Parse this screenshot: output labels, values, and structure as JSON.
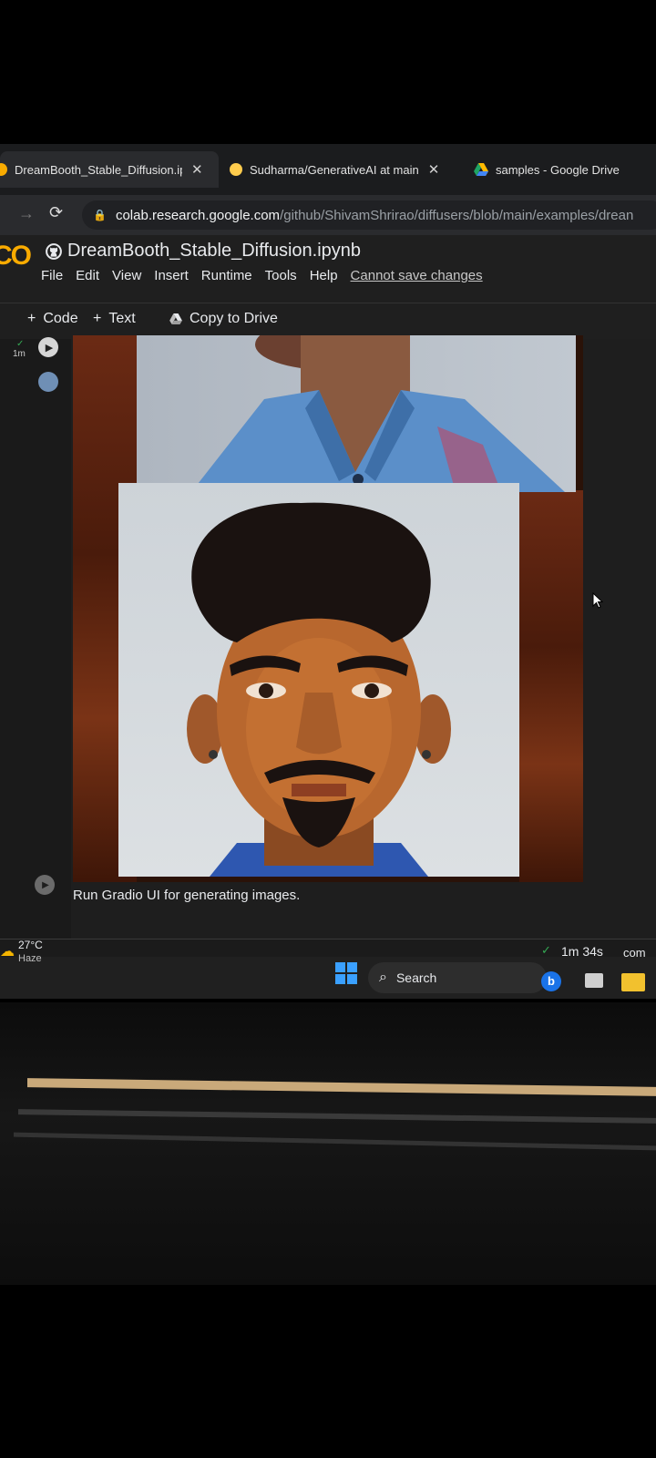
{
  "browser": {
    "tabs": [
      {
        "label": "DreamBooth_Stable_Diffusion.ipy",
        "active": true,
        "favicon_color": "#f9ab00"
      },
      {
        "label": "Sudharma/GenerativeAI at main",
        "active": false,
        "favicon_color": "#ffcc4d"
      },
      {
        "label": "samples - Google Drive",
        "active": false,
        "favicon_color": "#1fa463"
      }
    ],
    "close_glyph": "✕",
    "url_host": "colab.research.google.com",
    "url_path": "/github/ShivamShrirao/diffusers/blob/main/examples/drean"
  },
  "colab": {
    "logo": "CO",
    "notebook_title": "DreamBooth_Stable_Diffusion.ipynb",
    "menu": [
      "File",
      "Edit",
      "View",
      "Insert",
      "Runtime",
      "Tools",
      "Help"
    ],
    "save_notice": "Cannot save changes",
    "toolbar": {
      "code": "Code",
      "text": "Text",
      "copy_drive": "Copy to Drive",
      "plus": "+"
    },
    "cell_exec_time": "1m",
    "cell_text": "Run Gradio UI for generating images.",
    "status_time": "1m 34s",
    "status_truncated": "com"
  },
  "taskbar": {
    "temperature": "27°C",
    "weather": "Haze",
    "search_label": "Search"
  },
  "colors": {
    "accent_orange": "#f9ab00",
    "status_green": "#34a853",
    "windows_blue": "#3aa0ff"
  }
}
